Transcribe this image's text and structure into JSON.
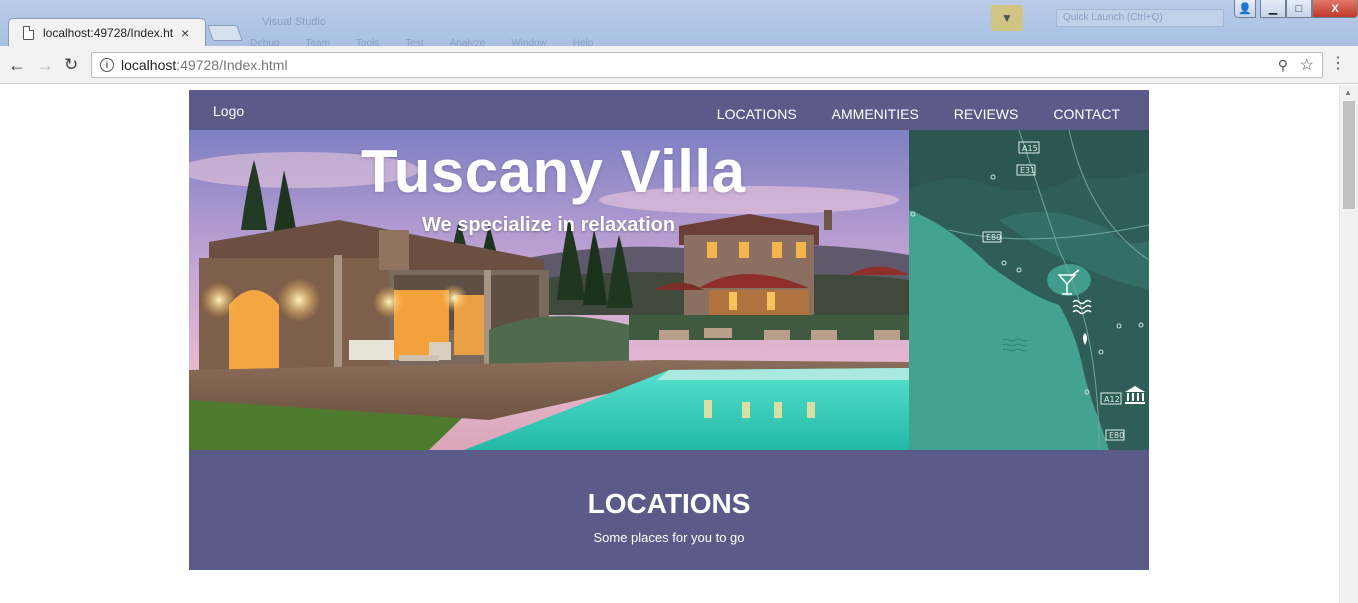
{
  "browser": {
    "tab_title": "localhost:49728/Index.ht",
    "tab_close": "×",
    "url_host": "localhost",
    "url_rest": ":49728/Index.html",
    "background_window_title": "Visual Studio",
    "background_menu": [
      "Debug",
      "Team",
      "Tools",
      "Test",
      "Analyze",
      "Window",
      "Help"
    ],
    "background_search_placeholder": "Quick Launch (Ctrl+Q)",
    "icons": {
      "back": "←",
      "forward": "→",
      "reload": "↻",
      "info": "i",
      "zoom": "⚲",
      "star": "☆",
      "menu": "⋮",
      "win_user": "👤",
      "win_min": "▁",
      "win_max": "□",
      "win_close": "X"
    }
  },
  "site": {
    "logo": "Logo",
    "nav": [
      "LOCATIONS",
      "AMMENITIES",
      "REVIEWS",
      "CONTACT"
    ],
    "hero_title": "Tuscany Villa",
    "hero_subtitle": "We specialize in relaxation",
    "locations_title": "LOCATIONS",
    "locations_subtitle": "Some places for you to go",
    "map_labels": [
      "A15",
      "E31",
      "E80",
      "A12",
      "E80"
    ]
  },
  "colors": {
    "nav_bg": "#5b5b8a",
    "map_land": "#2f5f5a",
    "map_sea": "#43a08f",
    "pool": "#3fd6c0"
  }
}
